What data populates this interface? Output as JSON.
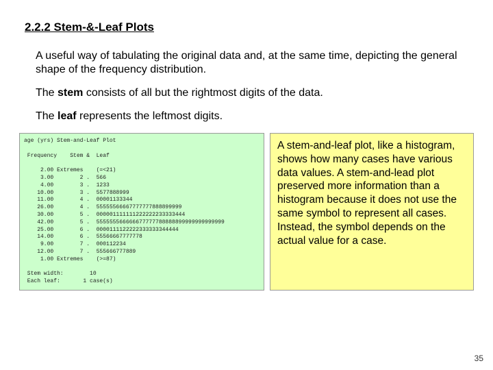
{
  "section_title": "2.2.2  Stem-&-Leaf Plots",
  "para1a": "A useful way of tabulating the original data and, at the same time, depicting the general shape of the frequency distribution.",
  "para2a": "The ",
  "para2b": "stem",
  "para2c": " consists of all but the rightmost digits of the data.",
  "para3a": "The ",
  "para3b": "leaf",
  "para3c": " represents the leftmost digits.",
  "plot_text": "age (yrs) Stem-and-Leaf Plot\n\n Frequency    Stem &  Leaf\n\n     2.00 Extremes    (=<21)\n     3.00        2 .  566\n     4.00        3 .  1233\n    10.00        3 .  5577888999\n    11.00        4 .  00001133344\n    26.00        4 .  55555566667777777888899999\n    30.00        5 .  000001111111222222233333444\n    42.00        5 .  555555566666677777788888899999999999999\n    25.00        6 .  0000111122222333333344444\n    14.00        6 .  55566667777778\n     9.00        7 .  000112234\n    12.00        7 .  555666777889\n     1.00 Extremes    (>=87)\n\n Stem width:        10\n Each leaf:       1 case(s)",
  "explain_text": "A stem-and-leaf plot, like a histogram, shows how many cases have various data values. A stem-and-lead plot preserved more information than a histogram because it does not use the same symbol to represent all cases.  Instead, the symbol depends on the actual value for a case.",
  "page_number": "35",
  "chart_data": {
    "type": "table",
    "title": "age (yrs) Stem-and-Leaf Plot",
    "stem_width": 10,
    "each_leaf_cases": 1,
    "extremes_low": {
      "frequency": 2,
      "condition": "=<21"
    },
    "extremes_high": {
      "frequency": 1,
      "condition": ">=87"
    },
    "rows": [
      {
        "frequency": 3,
        "stem": 2,
        "leaf": "566"
      },
      {
        "frequency": 4,
        "stem": 3,
        "leaf": "1233"
      },
      {
        "frequency": 10,
        "stem": 3,
        "leaf": "5577888999"
      },
      {
        "frequency": 11,
        "stem": 4,
        "leaf": "00001133344"
      },
      {
        "frequency": 26,
        "stem": 4,
        "leaf": "55555566667777777888899999"
      },
      {
        "frequency": 30,
        "stem": 5,
        "leaf": "000001111111222222233333444"
      },
      {
        "frequency": 42,
        "stem": 5,
        "leaf": "555555566666677777788888899999999999999"
      },
      {
        "frequency": 25,
        "stem": 6,
        "leaf": "0000111122222333333344444"
      },
      {
        "frequency": 14,
        "stem": 6,
        "leaf": "55566667777778"
      },
      {
        "frequency": 9,
        "stem": 7,
        "leaf": "000112234"
      },
      {
        "frequency": 12,
        "stem": 7,
        "leaf": "555666777889"
      }
    ]
  }
}
